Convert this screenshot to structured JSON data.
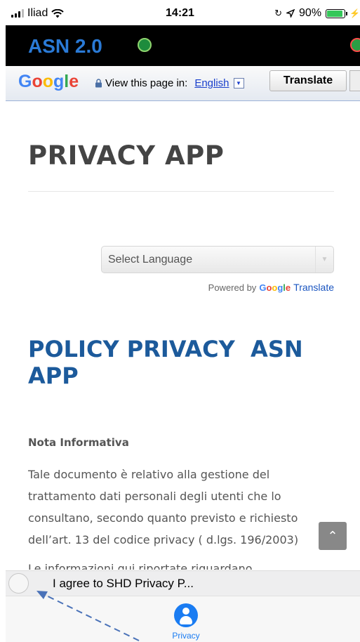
{
  "status_bar": {
    "carrier": "Iliad",
    "time": "14:21",
    "battery": "90%",
    "battery_level": 0.9
  },
  "header": {
    "title": "ASN 2.0"
  },
  "google_translate": {
    "logo": "Google",
    "view_label": "View this page in:",
    "language": "English",
    "translate_button": "Translate"
  },
  "page": {
    "title": "PRIVACY APP",
    "select_language": "Select Language",
    "powered_by": "Powered by",
    "powered_google": "Google",
    "powered_translate": "Translate",
    "policy_title": "POLICY PRIVACY  ASN APP",
    "section_heading": "Nota Informativa",
    "body": "Tale documento è relativo alla gestione del trattamento dati personali degli utenti che lo consultano, secondo quanto previsto e richiesto dell’art. 13 del codice privacy ( d.lgs. 196/2003)",
    "body_cut": "Le informazioni qui riportate riguardano"
  },
  "agreement": {
    "label": "I agree to SHD Privacy P..."
  },
  "tab_bar": {
    "items": [
      {
        "label": "Privacy"
      }
    ]
  },
  "colors": {
    "accent": "#1a7cf2",
    "policy_title": "#1c5a9b",
    "header_bg": "#000000",
    "app_title": "#2a7ad6"
  }
}
